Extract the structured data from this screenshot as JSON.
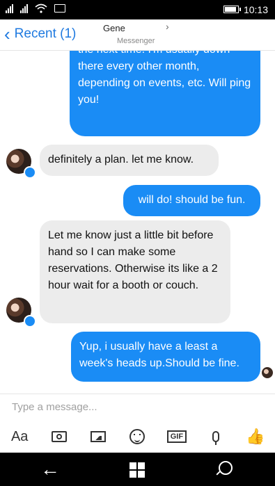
{
  "status_bar": {
    "time": "10:13"
  },
  "header": {
    "back_label": "Recent (1)",
    "contact_name": "Gene",
    "app_name": "Messenger"
  },
  "messages": [
    {
      "from": "me",
      "text": "nah, definitely. Will let you know the next time. I'm usually down there every other month, depending on events, etc. Will ping you!"
    },
    {
      "from": "them",
      "text": "definitely a plan. let me know."
    },
    {
      "from": "me",
      "text": "will do! should be fun."
    },
    {
      "from": "them",
      "text": "Let me know just a little bit before hand so I can make some reservations. Otherwise its like a 2 hour wait for a booth or couch."
    },
    {
      "from": "me",
      "text": "Yup, i usually have a least a week's heads up.Should be fine."
    }
  ],
  "composer": {
    "placeholder": "Type a message..."
  },
  "toolbar": {
    "text_format_label": "Aa",
    "gif_label": "GIF"
  },
  "colors": {
    "accent": "#1a8cf5",
    "incoming_bubble": "#ececec"
  },
  "icons": [
    "back-chevron-icon",
    "camera-icon",
    "image-icon",
    "emoji-icon",
    "gif-icon",
    "microphone-icon",
    "like-icon"
  ]
}
